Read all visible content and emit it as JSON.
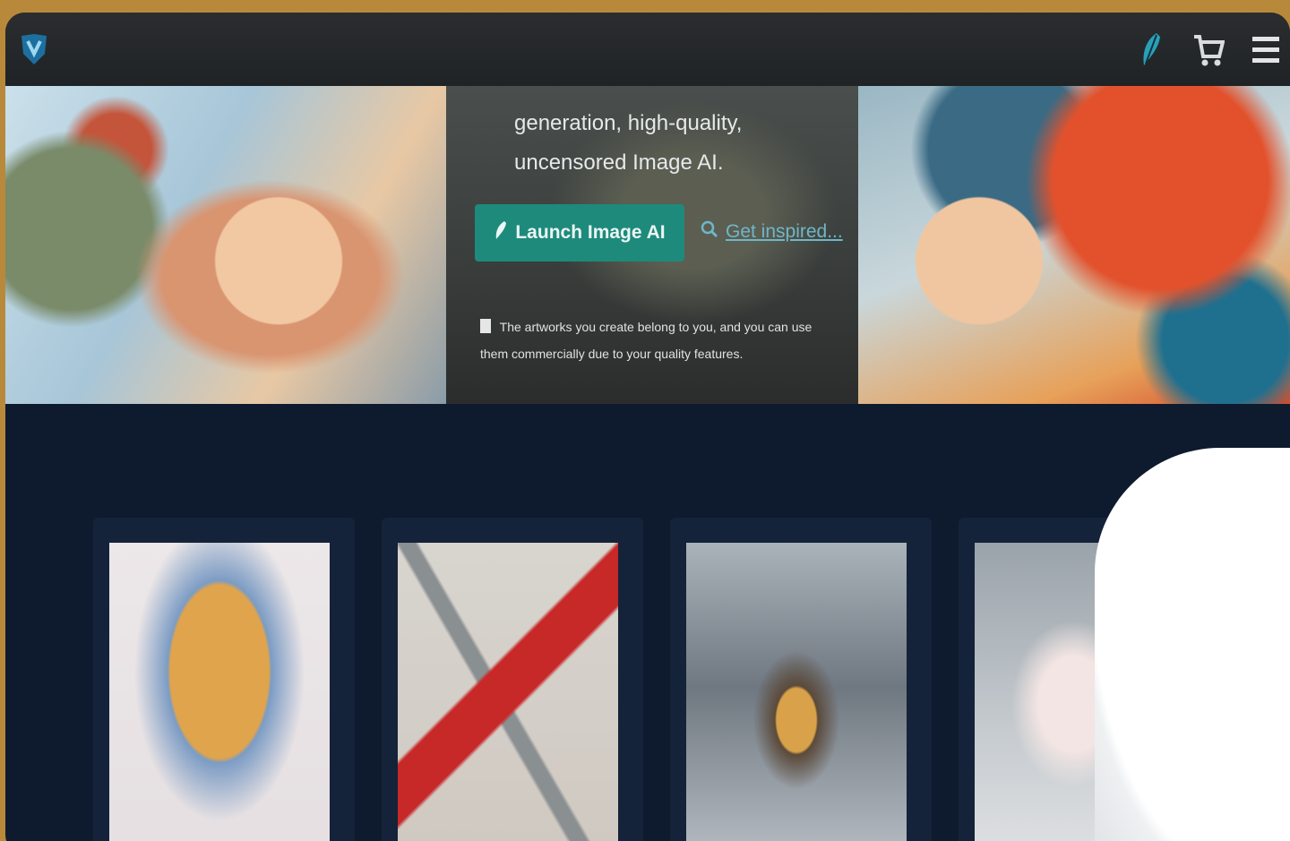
{
  "header": {
    "icons": {
      "logo": "shield-logo-icon",
      "feather": "feather-icon",
      "cart": "cart-icon",
      "menu": "menu-icon"
    }
  },
  "hero": {
    "text_line1": "generation, high-quality,",
    "text_line2": "uncensored Image AI.",
    "launch_button": "Launch Image AI",
    "launch_icon": "feather-icon",
    "inspire_link": "Get inspired...",
    "inspire_icon": "search-icon",
    "note_line1": "The artworks you create belong to you, and you can use",
    "note_line2": "them commercially due to your quality features."
  },
  "gallery": {
    "cards": [
      {
        "name": "artwork-1"
      },
      {
        "name": "artwork-2"
      },
      {
        "name": "artwork-3"
      },
      {
        "name": "artwork-4"
      }
    ]
  },
  "colors": {
    "accent": "#1e8a7c",
    "link": "#6fb7c8",
    "background": "#0e1a2e",
    "frame_border": "#b8893a"
  }
}
